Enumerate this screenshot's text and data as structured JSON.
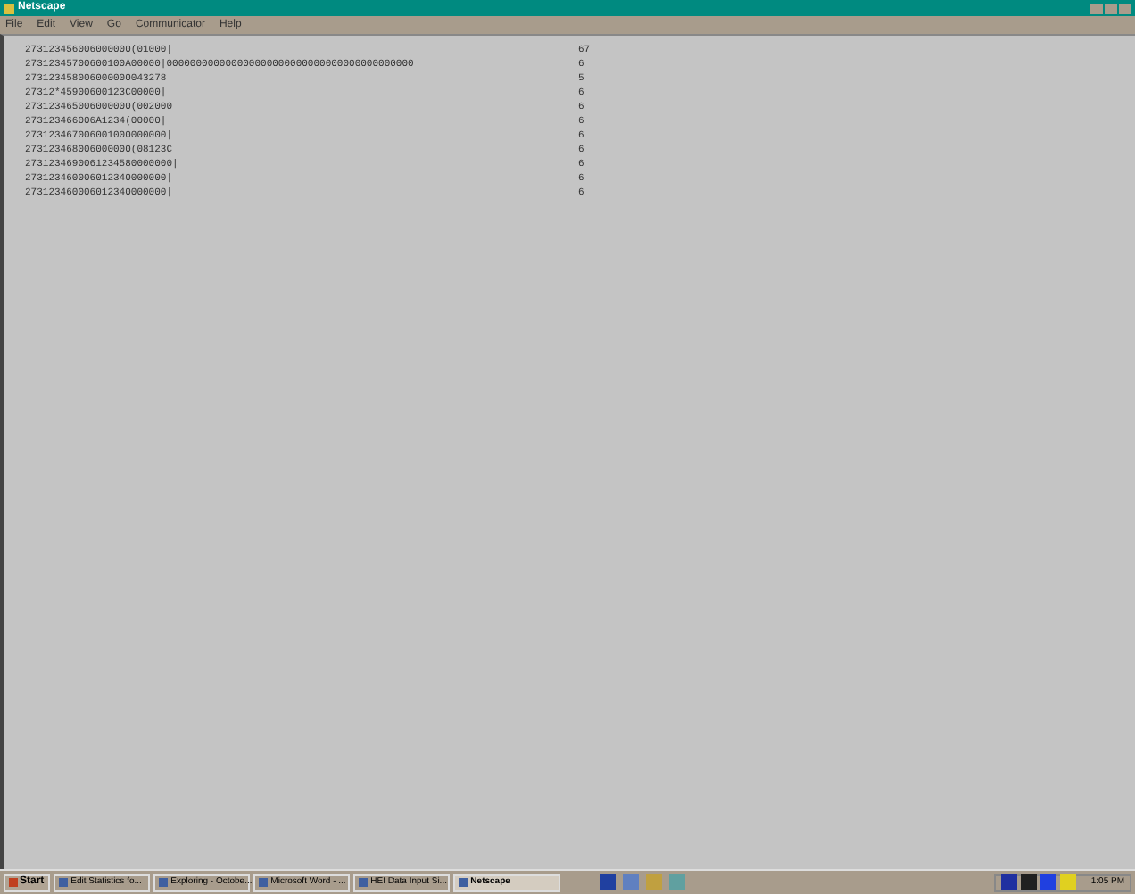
{
  "window": {
    "title": "Netscape"
  },
  "menu": [
    "File",
    "Edit",
    "View",
    "Go",
    "Communicator",
    "Help"
  ],
  "rows": [
    {
      "text": "273123456006000000(01000|",
      "count": "67"
    },
    {
      "text": "27312345700600100A00000|000000000000000000000000000000000000000000",
      "count": "6"
    },
    {
      "text": "273123458006000000043278",
      "count": "5"
    },
    {
      "text": "27312*45900600123C00000|",
      "count": "6"
    },
    {
      "text": "273123465006000000(002000",
      "count": "6"
    },
    {
      "text": "273123466006A1234(00000|",
      "count": "6"
    },
    {
      "text": "273123467006001000000000|",
      "count": "6"
    },
    {
      "text": "273123468006000000(08123C",
      "count": "6"
    },
    {
      "text": "2731234690061234580000000|",
      "count": "6"
    },
    {
      "text": "273123460006012340000000|",
      "count": "6"
    },
    {
      "text": "273123460006012340000000|",
      "count": "6"
    }
  ],
  "taskbar": {
    "start": "Start",
    "tasks": [
      {
        "label": "Edit Statistics fo...",
        "selected": false
      },
      {
        "label": "Exploring - Octobe...",
        "selected": false
      },
      {
        "label": "Microsoft Word - ...",
        "selected": false
      },
      {
        "label": "HEI Data Input Si...",
        "selected": false
      },
      {
        "label": "Netscape",
        "selected": true
      }
    ],
    "clock": "1:05 PM"
  }
}
